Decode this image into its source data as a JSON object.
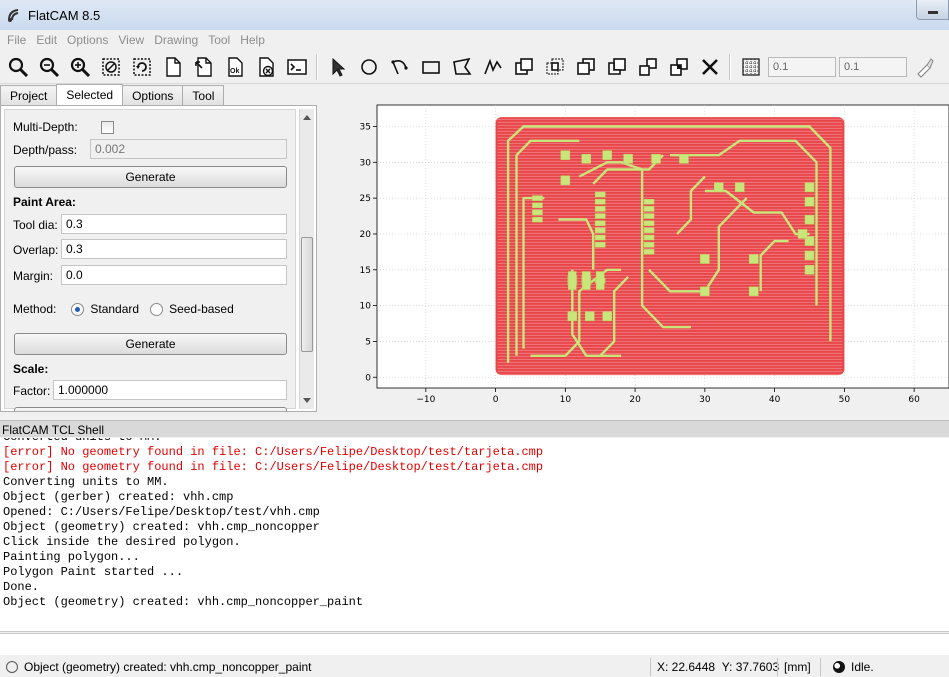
{
  "window": {
    "title": "FlatCAM 8.5"
  },
  "menu": [
    "File",
    "Edit",
    "Options",
    "View",
    "Drawing",
    "Tool",
    "Help"
  ],
  "toolbar": {
    "icons": [
      "zoom-fit-icon",
      "zoom-out-icon",
      "zoom-in-icon",
      "clear-plot-icon",
      "replot-icon",
      "new-file-icon",
      "open-file-icon",
      "ok-icon",
      "delete-icon",
      "shell-icon"
    ],
    "draw_icons": [
      "select-arrow-icon",
      "circle-icon",
      "arc-icon",
      "rectangle-icon",
      "polygon-icon",
      "path-icon",
      "union-icon",
      "intersection-icon",
      "subtract-icon",
      "cut-icon",
      "copy-icon",
      "move-icon",
      "delete-shape-icon"
    ],
    "grid_x": "0.1",
    "grid_y": "0.1"
  },
  "tabs": [
    {
      "label": "Project",
      "active": false
    },
    {
      "label": "Selected",
      "active": true
    },
    {
      "label": "Options",
      "active": false
    },
    {
      "label": "Tool",
      "active": false
    }
  ],
  "panel": {
    "multi_depth_label": "Multi-Depth:",
    "depth_pass_label": "Depth/pass:",
    "depth_pass_value": "0.002",
    "generate_label_1": "Generate",
    "paint_area_title": "Paint Area:",
    "tool_dia_label": "Tool dia:",
    "tool_dia_value": "0.3",
    "overlap_label": "Overlap:",
    "overlap_value": "0.3",
    "margin_label": "Margin:",
    "margin_value": "0.0",
    "method_label": "Method:",
    "method_standard": "Standard",
    "method_seed": "Seed-based",
    "generate_label_2": "Generate",
    "scale_title": "Scale:",
    "factor_label": "Factor:",
    "factor_value": "1.000000"
  },
  "plot": {
    "x_ticks": [
      "−10",
      "0",
      "10",
      "20",
      "30",
      "40",
      "50",
      "60"
    ],
    "y_ticks": [
      "0",
      "5",
      "10",
      "15",
      "20",
      "25",
      "30",
      "35"
    ],
    "x_range": [
      -17,
      65
    ],
    "y_range": [
      -1.5,
      38
    ],
    "board_x": [
      0,
      50
    ],
    "board_y": [
      0.3,
      36.3
    ],
    "fill_color": "#e8464a",
    "copper_color": "#c8e67a"
  },
  "shell": {
    "title": "FlatCAM TCL Shell",
    "lines": [
      {
        "text": "Converted units to MM.",
        "type": "partial"
      },
      {
        "text": "[error] No geometry found in file: C:/Users/Felipe/Desktop/test/tarjeta.cmp",
        "type": "err"
      },
      {
        "text": "[error] No geometry found in file: C:/Users/Felipe/Desktop/test/tarjeta.cmp",
        "type": "err"
      },
      {
        "text": "Converting units to MM.",
        "type": "ok"
      },
      {
        "text": "Object (gerber) created: vhh.cmp",
        "type": "ok"
      },
      {
        "text": "Opened: C:/Users/Felipe/Desktop/test/vhh.cmp",
        "type": "ok"
      },
      {
        "text": "Object (geometry) created: vhh.cmp_noncopper",
        "type": "ok"
      },
      {
        "text": "Click inside the desired polygon.",
        "type": "ok"
      },
      {
        "text": "Painting polygon...",
        "type": "ok"
      },
      {
        "text": "Polygon Paint started ...",
        "type": "ok"
      },
      {
        "text": "Done.",
        "type": "ok"
      },
      {
        "text": "Object (geometry) created: vhh.cmp_noncopper_paint",
        "type": "ok"
      }
    ]
  },
  "status": {
    "message": "Object (geometry) created: vhh.cmp_noncopper_paint",
    "x": "X: 22.6448",
    "y": "Y: 37.7603",
    "units": "[mm]",
    "state": "Idle."
  }
}
